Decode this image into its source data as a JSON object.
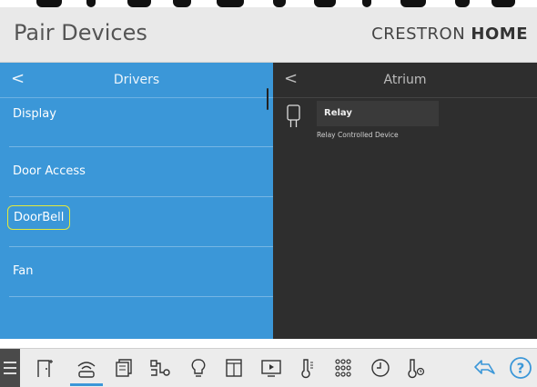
{
  "header": {
    "title": "Pair Devices",
    "brand_light": "CRESTRON",
    "brand_bold": "HOME"
  },
  "drivers_pane": {
    "back_icon": "chevron-left-icon",
    "title": "Drivers",
    "items": [
      {
        "label": "Display"
      },
      {
        "label": "Door Access"
      },
      {
        "label": "DoorBell",
        "selected": true
      },
      {
        "label": "Fan"
      }
    ]
  },
  "room_pane": {
    "back_icon": "chevron-left-icon",
    "title": "Atrium",
    "devices": [
      {
        "name": "Relay",
        "description": "Relay Controlled Device",
        "icon": "relay-icon"
      }
    ]
  },
  "toolbar": {
    "items": [
      "menu-icon",
      "door-icon",
      "wireless-icon",
      "shades-icon",
      "climate-network-icon",
      "light-bulb-icon",
      "window-icon",
      "media-play-icon",
      "thermometer-icon",
      "keypad-icon",
      "clock-icon",
      "temperature-sensor-icon",
      "share-icon",
      "help-icon"
    ],
    "active": "wireless-icon"
  },
  "colors": {
    "drivers_bg": "#3b97d8",
    "room_bg": "#2e2e2e",
    "selected_outline": "#e4ea3a",
    "toolbar_bg": "#ececec"
  }
}
